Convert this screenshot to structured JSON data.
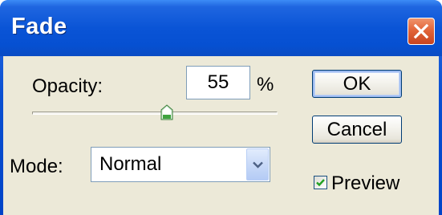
{
  "window": {
    "title": "Fade"
  },
  "opacity": {
    "label": "Opacity:",
    "value": "55",
    "unit": "%",
    "slider_percent": 55
  },
  "mode": {
    "label": "Mode:",
    "selected": "Normal"
  },
  "buttons": {
    "ok": "OK",
    "cancel": "Cancel"
  },
  "preview": {
    "label": "Preview",
    "checked": true
  },
  "colors": {
    "titlebar": "#0a54d6",
    "close_button": "#e2653a",
    "dialog_face": "#ece9d8",
    "slider_thumb": "#3fa33f",
    "checkmark": "#21a121"
  },
  "icons": {
    "close": "close-x-icon",
    "dropdown": "chevron-down-icon",
    "check": "checkmark-icon",
    "slider_thumb": "slider-thumb-icon"
  }
}
